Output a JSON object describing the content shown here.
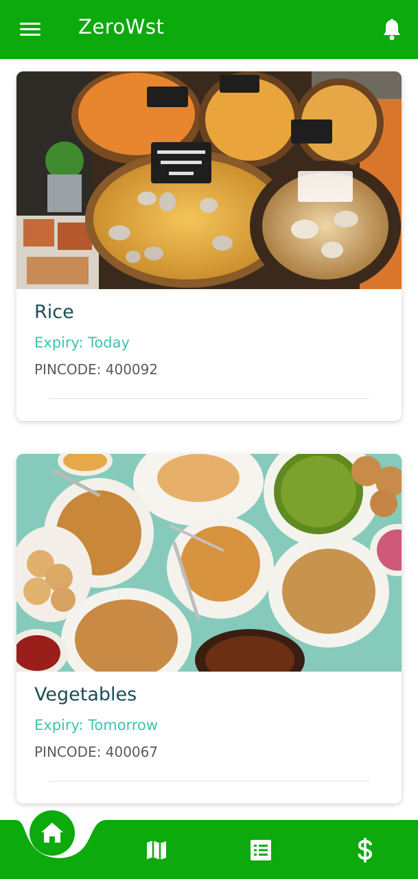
{
  "app": {
    "title": "ZeroWst",
    "brand_color": "#0caa0c"
  },
  "header": {
    "menu_icon": "hamburger-menu-icon",
    "notification_icon": "bell-icon"
  },
  "listings": [
    {
      "title": "Rice",
      "expiry": "Expiry: Today",
      "pincode": "PINCODE: 400092",
      "image": "assorted seafood and noodle dishes in takeaway boxes"
    },
    {
      "title": "Vegetables",
      "expiry": "Expiry: Tomorrow",
      "pincode": "PINCODE: 400067",
      "image": "assorted chaat snacks including pani puri and bhel"
    }
  ],
  "bottom_nav": {
    "items": [
      {
        "icon": "home-icon",
        "active": true
      },
      {
        "icon": "map-icon",
        "active": false
      },
      {
        "icon": "list-icon",
        "active": false
      },
      {
        "icon": "dollar-icon",
        "active": false
      }
    ]
  },
  "colors": {
    "title_text": "#1b4c55",
    "expiry_text": "#3ac4ad",
    "pincode_text": "#555b5e"
  }
}
